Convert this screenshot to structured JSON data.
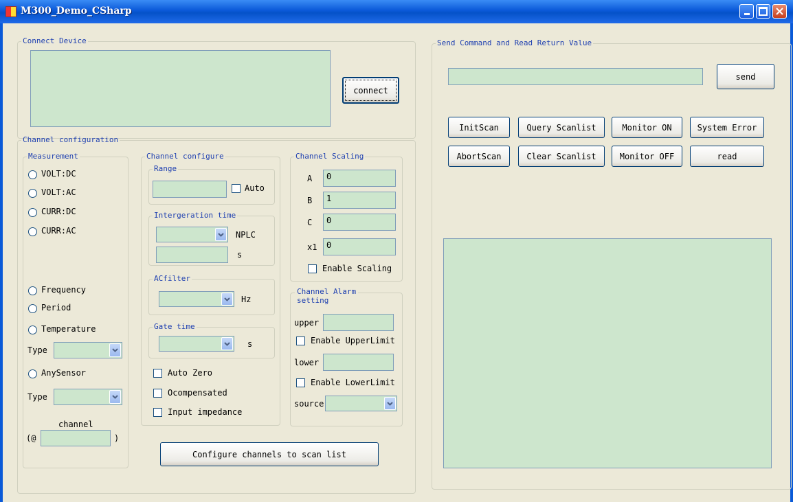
{
  "window": {
    "title": "M300_Demo_CSharp"
  },
  "connect": {
    "legend": "Connect Device",
    "button": "connect",
    "text": ""
  },
  "channel_config": {
    "legend": "Channel configuration",
    "measurement": {
      "legend": "Measurement",
      "volt_dc": "VOLT:DC",
      "volt_ac": "VOLT:AC",
      "curr_dc": "CURR:DC",
      "curr_ac": "CURR:AC",
      "frequency": "Frequency",
      "period": "Period",
      "temperature": "Temperature",
      "type_label_1": "Type",
      "anysensor": "AnySensor",
      "type_label_2": "Type",
      "channel_label": "channel",
      "channel_prefix": "(@",
      "channel_suffix": ")"
    },
    "configure": {
      "legend": "Channel configure",
      "range_legend": "Range",
      "auto_label": "Auto",
      "integration_legend": "Intergeration time",
      "nplc_label": "NPLC",
      "s_label": "s",
      "acfilter_legend": "ACfilter",
      "hz_label": "Hz",
      "gate_legend": "Gate time",
      "gate_s_label": "s",
      "auto_zero": "Auto Zero",
      "ocompensated": "Ocompensated",
      "input_impedance": "Input impedance"
    },
    "scaling": {
      "legend": "Channel Scaling",
      "a_label": "A",
      "a_value": "0",
      "b_label": "B",
      "b_value": "1",
      "c_label": "C",
      "c_value": "0",
      "x1_label": "x1",
      "x1_value": "0",
      "enable_label": "Enable Scaling"
    },
    "alarm": {
      "legend_line1": "Channel Alarm",
      "legend_line2": "setting",
      "upper_label": "upper",
      "enable_upper": "Enable UpperLimit",
      "lower_label": "lower",
      "enable_lower": "Enable LowerLimit",
      "source_label": "source"
    },
    "scan_button": "Configure channels to scan list"
  },
  "command": {
    "legend": "Send Command and Read Return Value",
    "input_value": "",
    "send_button": "send",
    "buttons": {
      "initscan": "InitScan",
      "query_scanlist": "Query Scanlist",
      "monitor_on": "Monitor ON",
      "system_error": "System Error",
      "abortscan": "AbortScan",
      "clear_scanlist": "Clear Scanlist",
      "monitor_off": "Monitor OFF",
      "read": "read"
    },
    "output_text": ""
  },
  "icons": {
    "app": "app-icon",
    "minimize": "minimize-icon",
    "maximize": "maximize-icon",
    "close": "close-icon",
    "dropdown": "chevron-down-icon"
  },
  "colors": {
    "field_bg": "#cde6cd",
    "title_bar": "#0a58d8",
    "group_text": "#1f40b0",
    "window_bg": "#ece9d8"
  }
}
